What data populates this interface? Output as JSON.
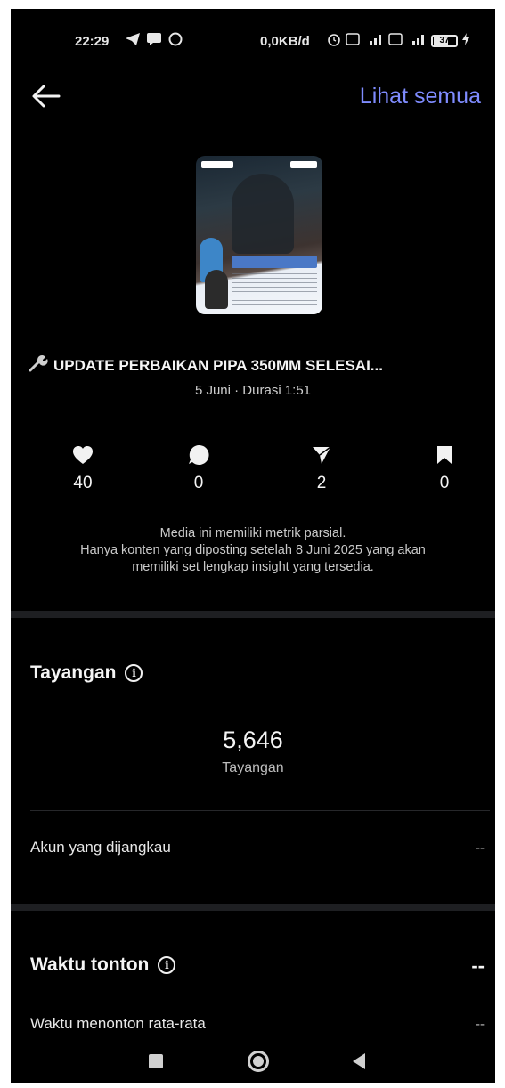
{
  "status_bar": {
    "time": "22:29",
    "left_icons": [
      "telegram-icon",
      "message-icon",
      "whatsapp-icon"
    ],
    "network_speed": "0,0KB/d",
    "battery_level": "37"
  },
  "header": {
    "see_all_label": "Lihat semua"
  },
  "post": {
    "title": "UPDATE PERBAIKAN PIPA 350MM SELESAI...",
    "meta": "5 Juni · Durasi 1:51"
  },
  "metrics": {
    "likes": "40",
    "comments": "0",
    "shares": "2",
    "saves": "0"
  },
  "note": {
    "line1": "Media ini memiliki metrik parsial.",
    "line2": "Hanya konten yang diposting setelah 8 Juni 2025 yang akan",
    "line3": "memiliki set lengkap insight yang tersedia."
  },
  "views": {
    "section_title": "Tayangan",
    "count": "5,646",
    "count_label": "Tayangan",
    "reach_label": "Akun yang dijangkau",
    "reach_value": "--"
  },
  "watch_time": {
    "section_title": "Waktu tonton",
    "total_value": "--",
    "avg_label": "Waktu menonton rata-rata",
    "avg_value": "--"
  }
}
